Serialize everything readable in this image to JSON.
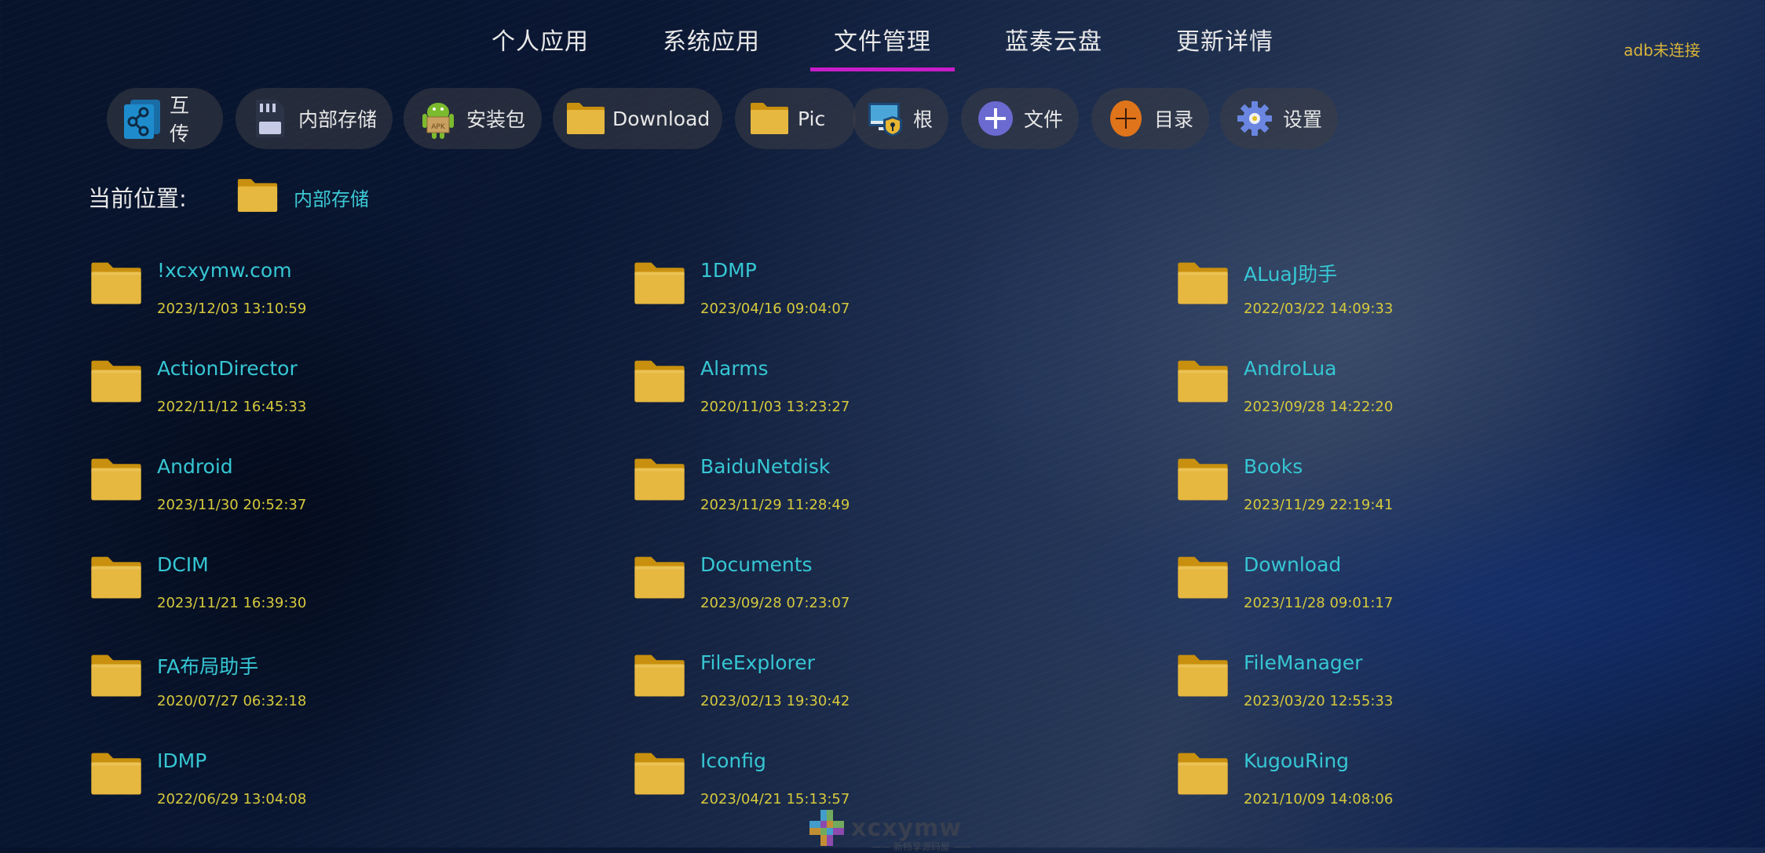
{
  "theme": {
    "accent": "#c81dc8",
    "name_color": "#36c6d3",
    "date_color": "#d6c93c",
    "status_color": "#d9b43a"
  },
  "tabs": [
    {
      "label": "个人应用",
      "active": false
    },
    {
      "label": "系统应用",
      "active": false
    },
    {
      "label": "文件管理",
      "active": true
    },
    {
      "label": "蓝奏云盘",
      "active": false
    },
    {
      "label": "更新详情",
      "active": false
    }
  ],
  "adb_status": "adb未连接",
  "toolbar": [
    {
      "label": "互传",
      "icon": "share-icon"
    },
    {
      "label": "内部存储",
      "icon": "sd-card-icon"
    },
    {
      "label": "安装包",
      "icon": "apk-android-icon"
    },
    {
      "label": "Download",
      "icon": "folder-icon"
    },
    {
      "label": "Pic",
      "icon": "folder-icon"
    },
    {
      "label": "根",
      "icon": "root-monitor-shield-icon"
    },
    {
      "label": "文件",
      "icon": "add-file-icon"
    },
    {
      "label": "目录",
      "icon": "add-folder-icon"
    },
    {
      "label": "设置",
      "icon": "gear-icon"
    }
  ],
  "location": {
    "label": "当前位置:",
    "path": "内部存储"
  },
  "files": [
    {
      "name": "!xcxymw.com",
      "date": "2023/12/03 13:10:59"
    },
    {
      "name": "1DMP",
      "date": "2023/04/16 09:04:07"
    },
    {
      "name": "ALuaJ助手",
      "date": "2022/03/22 14:09:33"
    },
    {
      "name": "ActionDirector",
      "date": "2022/11/12 16:45:33"
    },
    {
      "name": "Alarms",
      "date": "2020/11/03 13:23:27"
    },
    {
      "name": "AndroLua",
      "date": "2023/09/28 14:22:20"
    },
    {
      "name": "Android",
      "date": "2023/11/30 20:52:37"
    },
    {
      "name": "BaiduNetdisk",
      "date": "2023/11/29 11:28:49"
    },
    {
      "name": "Books",
      "date": "2023/11/29 22:19:41"
    },
    {
      "name": "DCIM",
      "date": "2023/11/21 16:39:30"
    },
    {
      "name": "Documents",
      "date": "2023/09/28 07:23:07"
    },
    {
      "name": "Download",
      "date": "2023/11/28 09:01:17"
    },
    {
      "name": "FA布局助手",
      "date": "2020/07/27 06:32:18"
    },
    {
      "name": "FileExplorer",
      "date": "2023/02/13 19:30:42"
    },
    {
      "name": "FileManager",
      "date": "2023/03/20 12:55:33"
    },
    {
      "name": "IDMP",
      "date": "2022/06/29 13:04:08"
    },
    {
      "name": "Iconfig",
      "date": "2023/04/21 15:13:57"
    },
    {
      "name": "KugouRing",
      "date": "2021/10/09 14:08:06"
    }
  ],
  "watermark": {
    "text": "xcxymw",
    "subtitle": "—— 新畅享源码屋 ——"
  }
}
